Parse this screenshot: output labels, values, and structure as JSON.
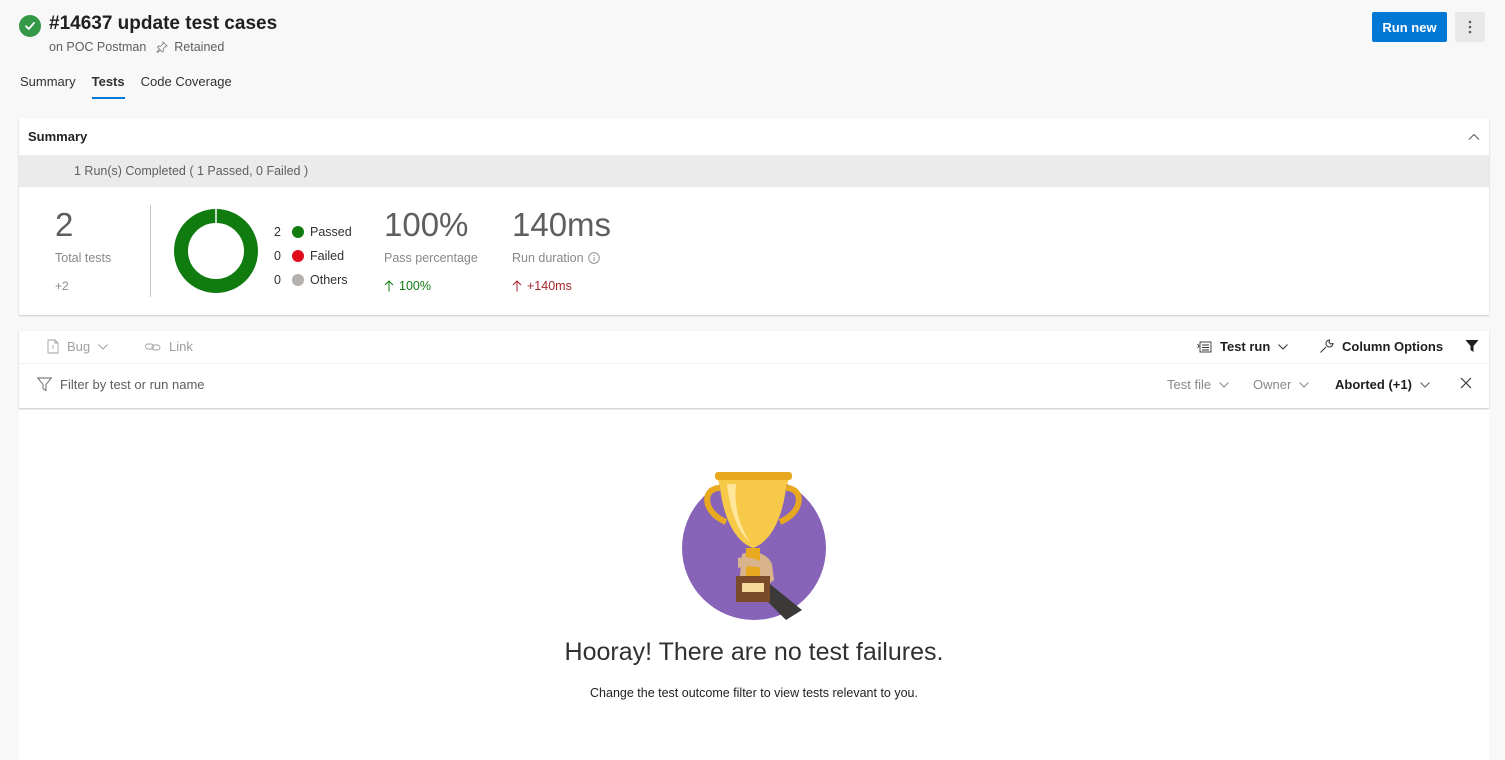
{
  "header": {
    "title": "#14637 update test cases",
    "pipeline": "on POC Postman",
    "retained": "Retained",
    "run_new_label": "Run new",
    "status": "succeeded"
  },
  "tabs": [
    {
      "label": "Summary",
      "active": false
    },
    {
      "label": "Tests",
      "active": true
    },
    {
      "label": "Code Coverage",
      "active": false
    }
  ],
  "summary": {
    "heading": "Summary",
    "runs_banner": "1 Run(s) Completed ( 1 Passed, 0 Failed )",
    "total_tests": "2",
    "total_label": "Total tests",
    "total_delta": "+2",
    "legend": [
      {
        "count": "2",
        "label": "Passed",
        "color": "#107c10"
      },
      {
        "count": "0",
        "label": "Failed",
        "color": "#e00b1c"
      },
      {
        "count": "0",
        "label": "Others",
        "color": "#b3b0ad"
      }
    ],
    "pass_percentage": "100%",
    "pass_label": "Pass percentage",
    "pass_delta": "100%",
    "run_duration": "140ms",
    "duration_label": "Run duration",
    "duration_delta": "+140ms"
  },
  "toolbar": {
    "bug_label": "Bug",
    "link_label": "Link",
    "group_by_label": "Test run",
    "column_options_label": "Column Options"
  },
  "filters": {
    "search_placeholder": "Filter by test or run name",
    "test_file": "Test file",
    "owner": "Owner",
    "outcome": "Aborted (+1)"
  },
  "empty_state": {
    "title": "Hooray! There are no test failures.",
    "hint": "Change the test outcome filter to view tests relevant to you."
  },
  "colors": {
    "accent": "#0078d4",
    "success": "#339947",
    "trophy_bg": "#8764b8"
  }
}
